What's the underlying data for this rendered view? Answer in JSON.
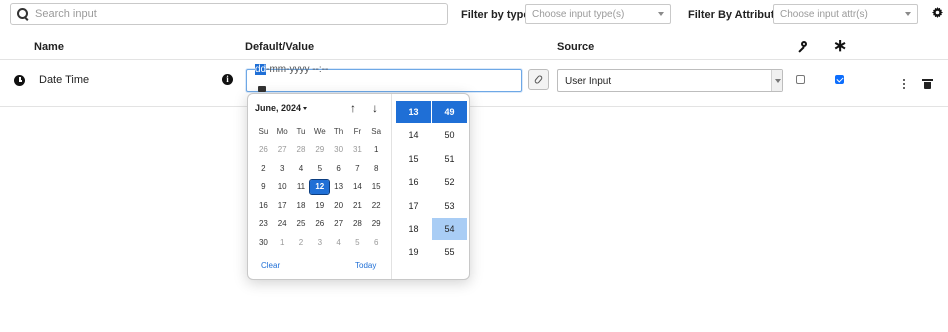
{
  "toolbar": {
    "search_placeholder": "Search input",
    "filter_type_label": "Filter by type",
    "filter_type_placeholder": "Choose input type(s)",
    "filter_attr_label": "Filter By Attribute",
    "filter_attr_placeholder": "Choose input attr(s)"
  },
  "columns": {
    "name": "Name",
    "default_value": "Default/Value",
    "source": "Source"
  },
  "row": {
    "name": "Date Time",
    "value_day": "dd",
    "value_rest": "-mm-yyyy --:--",
    "source": "User Input",
    "key_checked": false,
    "required_checked": true
  },
  "picker": {
    "month_label": "June, 2024",
    "weekdays": [
      "Su",
      "Mo",
      "Tu",
      "We",
      "Th",
      "Fr",
      "Sa"
    ],
    "weeks": [
      [
        "26",
        "27",
        "28",
        "29",
        "30",
        "31",
        "1"
      ],
      [
        "2",
        "3",
        "4",
        "5",
        "6",
        "7",
        "8"
      ],
      [
        "9",
        "10",
        "11",
        "12",
        "13",
        "14",
        "15"
      ],
      [
        "16",
        "17",
        "18",
        "19",
        "20",
        "21",
        "22"
      ],
      [
        "23",
        "24",
        "25",
        "26",
        "27",
        "28",
        "29"
      ],
      [
        "30",
        "1",
        "2",
        "3",
        "4",
        "5",
        "6"
      ]
    ],
    "selected_day": "12",
    "hours": [
      "13",
      "14",
      "15",
      "16",
      "17",
      "18",
      "19"
    ],
    "minutes": [
      "49",
      "50",
      "51",
      "52",
      "53",
      "54",
      "55"
    ],
    "selected_hour": "13",
    "selected_minute": "49",
    "hover_minute": "54",
    "clear_label": "Clear",
    "today_label": "Today"
  },
  "colors": {
    "accent": "#1f6fd6",
    "hover": "#a9cdf5"
  }
}
